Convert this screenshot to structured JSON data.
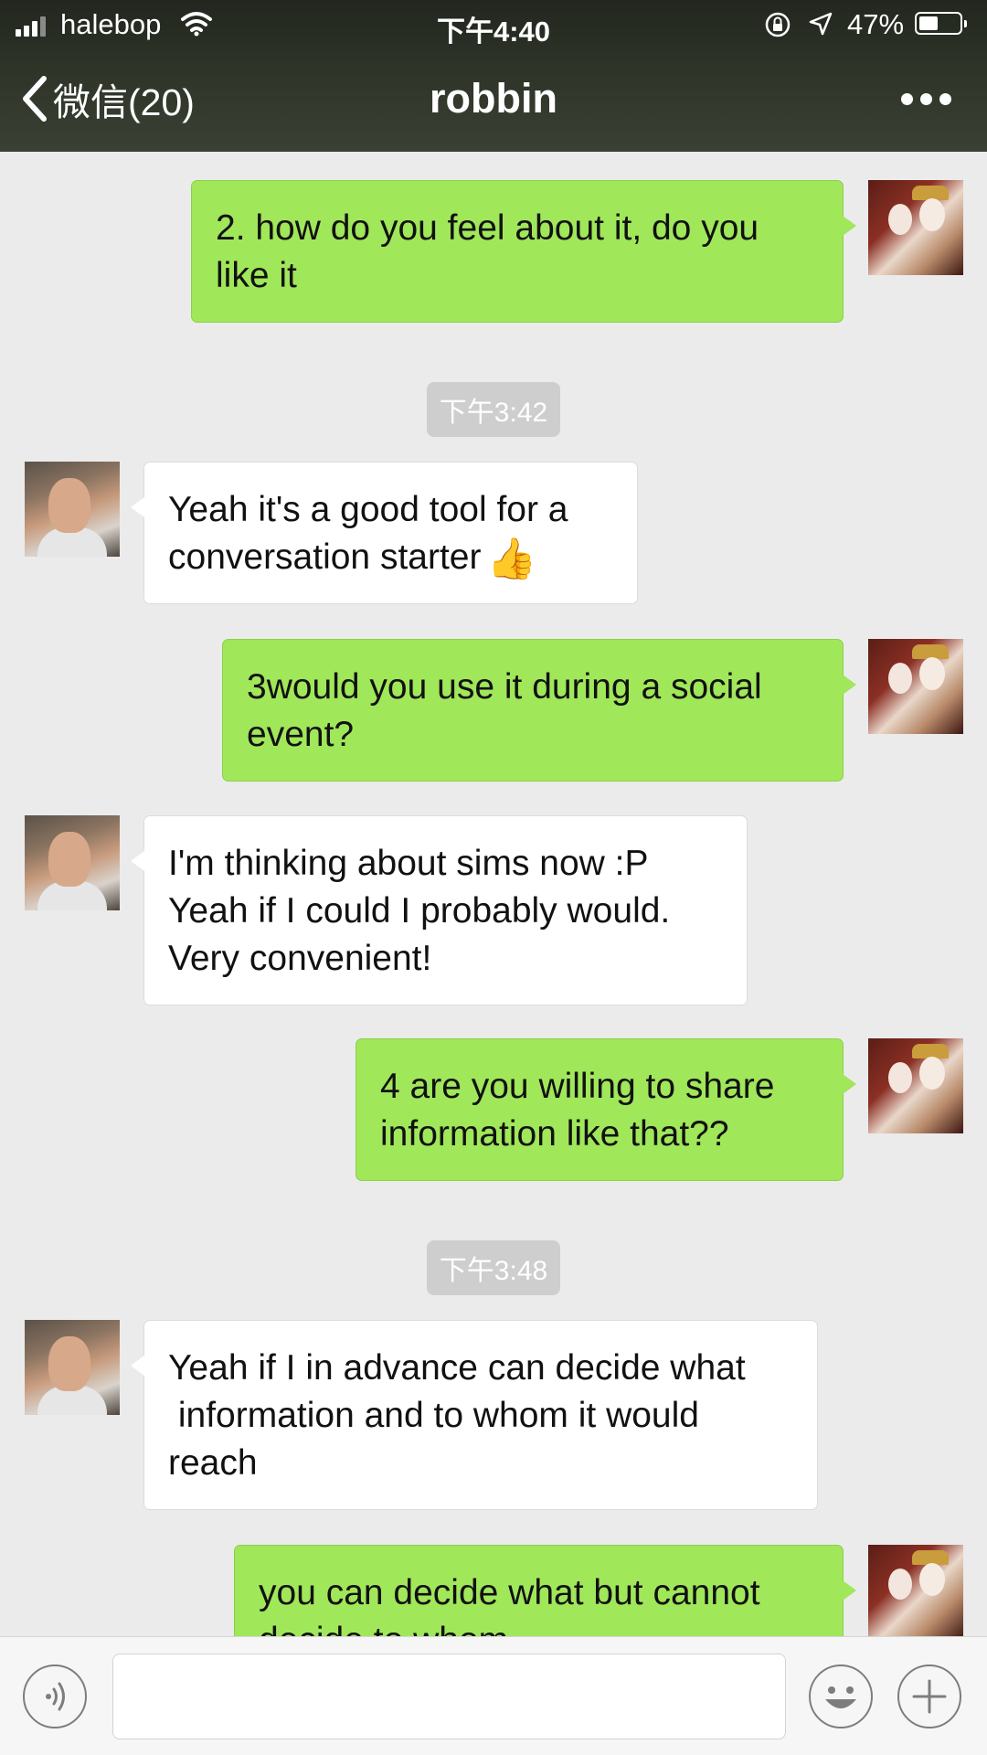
{
  "status_bar": {
    "carrier": "halebop",
    "time": "下午4:40",
    "battery_percent": "47%",
    "battery_level": 0.47
  },
  "nav": {
    "back_label": "微信(20)",
    "title": "robbin"
  },
  "messages": [
    {
      "from": "me",
      "text": "2. how do you feel about it, do you\nlike it"
    },
    {
      "type": "time",
      "text": "下午3:42"
    },
    {
      "from": "them",
      "text": "Yeah it's a good tool for a\nconversation starter",
      "emoji": "👍"
    },
    {
      "from": "me",
      "text": "3would you use it during a social\nevent?"
    },
    {
      "from": "them",
      "text": "I'm thinking about sims now :P\nYeah if I could I probably would.\nVery convenient!"
    },
    {
      "from": "me",
      "text": "4 are you willing to share\ninformation like that??"
    },
    {
      "type": "time",
      "text": "下午3:48"
    },
    {
      "from": "them",
      "text": "Yeah if I in advance can decide what\n information and to whom it would\nreach"
    },
    {
      "from": "me",
      "text": "you can decide what but cannot\ndecide to whom"
    }
  ],
  "input": {
    "value": "",
    "placeholder": ""
  },
  "icons": {
    "back": "chevron-left-icon",
    "more": "more-dots-icon",
    "voice": "voice-icon",
    "emoji": "emoji-icon",
    "plus": "plus-icon"
  },
  "colors": {
    "my_bubble": "#a0e75a",
    "their_bubble": "#ffffff",
    "chat_background": "#ebebeb",
    "header": "#2e3428"
  }
}
